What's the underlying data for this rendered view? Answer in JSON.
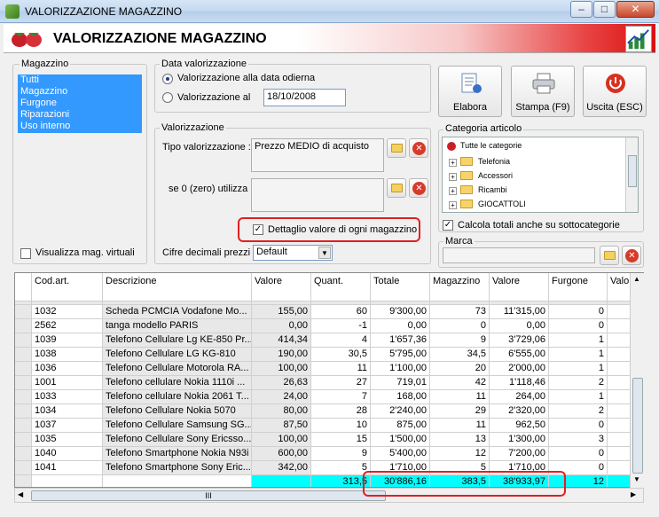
{
  "window": {
    "title": "VALORIZZAZIONE MAGAZZINO"
  },
  "banner": {
    "title": "VALORIZZAZIONE MAGAZZINO"
  },
  "magazzino": {
    "label": "Magazzino",
    "items": [
      "Tutti",
      "Magazzino",
      "Furgone",
      "Riparazioni",
      "Uso interno"
    ],
    "virtual_label": "Visualizza mag. virtuali"
  },
  "data_val": {
    "label": "Data valorizzazione",
    "opt1": "Valorizzazione alla data odierna",
    "opt2": "Valorizzazione al",
    "date": "18/10/2008"
  },
  "valorizzazione": {
    "label": "Valorizzazione",
    "tipo_label": "Tipo valorizzazione :",
    "tipo_value": "Prezzo MEDIO di acquisto",
    "zero_label": "se 0 (zero) utilizza :",
    "dettaglio_label": "Dettaglio valore di ogni magazzino",
    "cifre_label": "Cifre decimali prezzi :",
    "cifre_value": "Default"
  },
  "buttons": {
    "elabora": "Elabora",
    "stampa": "Stampa (F9)",
    "uscita": "Uscita (ESC)"
  },
  "categoria": {
    "label": "Categoria articolo",
    "root": "Tutte le categorie",
    "items": [
      "Telefonia",
      "Accessori",
      "Ricambi",
      "GIOCATTOLI"
    ],
    "calc_label": "Calcola totali anche su sottocategorie"
  },
  "marca": {
    "label": "Marca"
  },
  "grid": {
    "headers": [
      "Cod.art.",
      "Descrizione",
      "Valore",
      "Quant.",
      "Totale",
      "Magazzino",
      "Valore",
      "Furgone",
      "Valo"
    ],
    "rows": [
      [
        "1032",
        "Scheda PCMCIA Vodafone Mo...",
        "155,00",
        "60",
        "9'300,00",
        "73",
        "11'315,00",
        "0"
      ],
      [
        "2562",
        "tanga modello PARIS",
        "0,00",
        "-1",
        "0,00",
        "0",
        "0,00",
        "0"
      ],
      [
        "1039",
        "Telefono Cellulare Lg KE-850 Pr...",
        "414,34",
        "4",
        "1'657,36",
        "9",
        "3'729,06",
        "1"
      ],
      [
        "1038",
        "Telefono Cellulare LG KG-810",
        "190,00",
        "30,5",
        "5'795,00",
        "34,5",
        "6'555,00",
        "1"
      ],
      [
        "1036",
        "Telefono Cellulare Motorola RA...",
        "100,00",
        "11",
        "1'100,00",
        "20",
        "2'000,00",
        "1"
      ],
      [
        "1001",
        "Telefono cellulare Nokia 1110i ...",
        "26,63",
        "27",
        "719,01",
        "42",
        "1'118,46",
        "2"
      ],
      [
        "1033",
        "Telefono cellulare Nokia 2061 T...",
        "24,00",
        "7",
        "168,00",
        "11",
        "264,00",
        "1"
      ],
      [
        "1034",
        "Telefono Cellulare Nokia 5070",
        "80,00",
        "28",
        "2'240,00",
        "29",
        "2'320,00",
        "2"
      ],
      [
        "1037",
        "Telefono Cellulare Samsung SG...",
        "87,50",
        "10",
        "875,00",
        "11",
        "962,50",
        "0"
      ],
      [
        "1035",
        "Telefono Cellulare Sony Ericsso...",
        "100,00",
        "15",
        "1'500,00",
        "13",
        "1'300,00",
        "3"
      ],
      [
        "1040",
        "Telefono Smartphone Nokia N93i",
        "600,00",
        "9",
        "5'400,00",
        "12",
        "7'200,00",
        "0"
      ],
      [
        "1041",
        "Telefono Smartphone Sony Eric...",
        "342,00",
        "5",
        "1'710,00",
        "5",
        "1'710,00",
        "0"
      ]
    ],
    "totals": {
      "quant": "313,5",
      "totale": "30'886,16",
      "magazzino": "383,5",
      "valore": "38'933,97",
      "furgone": "12"
    },
    "hscroll_thumb": "III"
  }
}
